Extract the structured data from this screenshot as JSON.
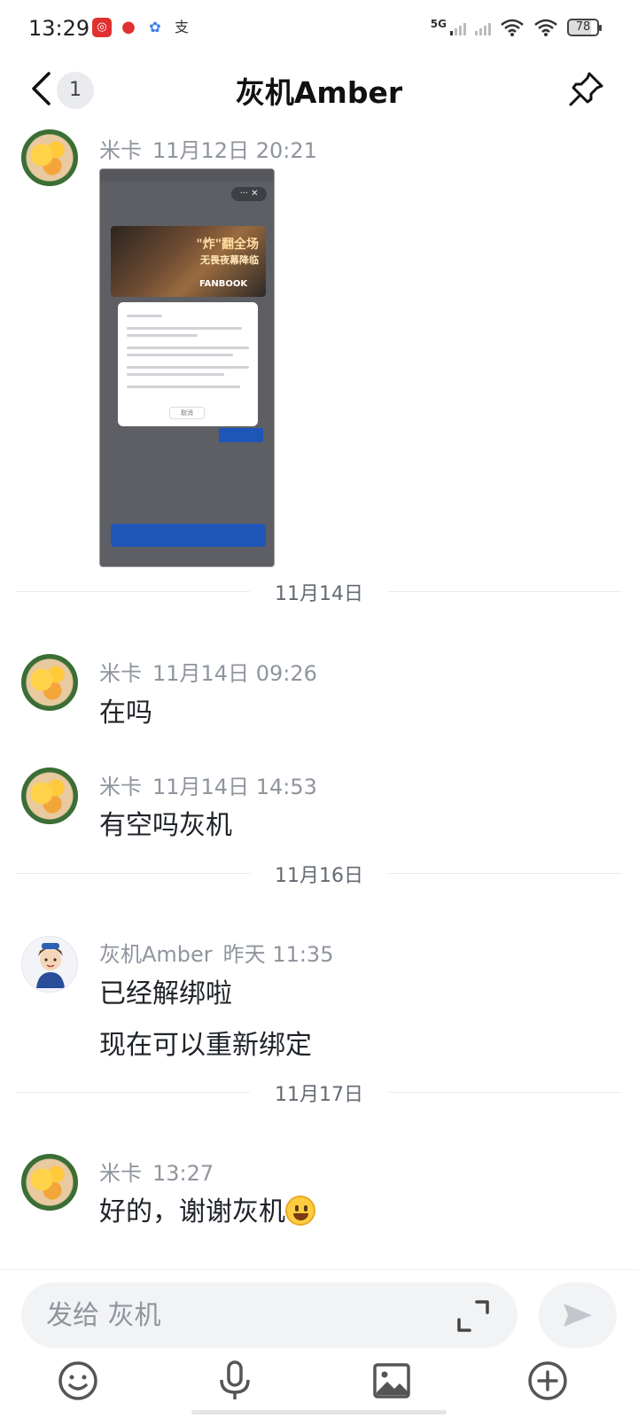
{
  "status_bar": {
    "time": "13:29",
    "network_label": "5G",
    "battery": "78",
    "app_icons": [
      "netease-music-icon",
      "maps-pin-icon",
      "paw-icon",
      "alipay-icon"
    ]
  },
  "header": {
    "unread_count": "1",
    "title": "灰机Amber"
  },
  "messages": [
    {
      "sender": "米卡",
      "time": "11月12日 20:21",
      "type": "image"
    },
    {
      "date_separator": "11月14日"
    },
    {
      "sender": "米卡",
      "time": "11月14日 09:26",
      "text": "在吗"
    },
    {
      "sender": "米卡",
      "time": "11月14日 14:53",
      "text": "有空吗灰机"
    },
    {
      "date_separator": "11月16日"
    },
    {
      "sender": "灰机Amber",
      "time": "昨天 11:35",
      "texts": [
        "已经解绑啦",
        "现在可以重新绑定"
      ]
    },
    {
      "date_separator": "11月17日"
    },
    {
      "sender": "米卡",
      "time": "13:27",
      "text": "好的，谢谢灰机"
    }
  ],
  "screenshot": {
    "banner_line1": "\"炸\"翻全场",
    "banner_line2": "无畏夜幕降临",
    "banner_line3": "FANBOOK",
    "cancel_label": "取消"
  },
  "input": {
    "placeholder": "发给 灰机"
  },
  "toolbar": [
    "emoji-icon",
    "microphone-icon",
    "image-icon",
    "plus-circle-icon"
  ],
  "colors": {
    "text_primary": "#1f2329",
    "text_secondary": "#8f959e",
    "input_bg": "#f2f3f5",
    "screenshot_blue": "#1e56b8"
  }
}
